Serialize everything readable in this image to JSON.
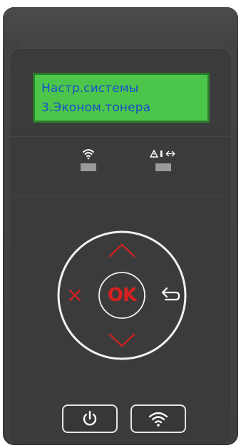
{
  "display": {
    "line1": "Настр.системы",
    "line2": "3.Эконом.тонера"
  },
  "indicators": {
    "wifi_icon": "wifi-icon",
    "error_icon": "warning-icon",
    "status_led_color": "#9a9a9a"
  },
  "dpad": {
    "ok_label": "OK",
    "up_icon": "chevron-up-icon",
    "down_icon": "chevron-down-icon",
    "cancel_icon": "close-icon",
    "back_icon": "back-arrow-icon",
    "accent_color": "#d9201f",
    "ring_color": "#f2f2f2"
  },
  "buttons": {
    "power_icon": "power-icon",
    "wifi_icon": "wifi-icon"
  },
  "colors": {
    "lcd_background": "#4cc64a",
    "lcd_text": "#1c4fc7",
    "panel": "#3b3b3b"
  }
}
